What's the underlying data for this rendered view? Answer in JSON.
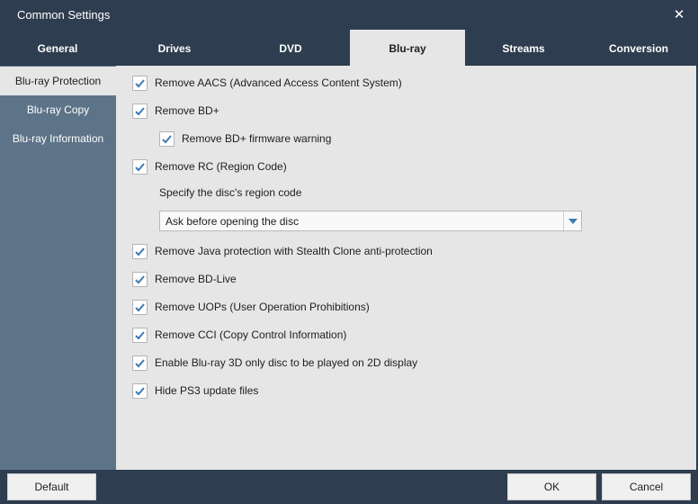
{
  "window": {
    "title": "Common Settings",
    "close_icon": "close-icon"
  },
  "tabs": [
    {
      "label": "General",
      "active": false
    },
    {
      "label": "Drives",
      "active": false
    },
    {
      "label": "DVD",
      "active": false
    },
    {
      "label": "Blu-ray",
      "active": true
    },
    {
      "label": "Streams",
      "active": false
    },
    {
      "label": "Conversion",
      "active": false
    }
  ],
  "sidebar": {
    "items": [
      {
        "label": "Blu-ray Protection",
        "active": true
      },
      {
        "label": "Blu-ray Copy",
        "active": false
      },
      {
        "label": "Blu-ray Information",
        "active": false
      }
    ]
  },
  "options": [
    {
      "label": "Remove AACS (Advanced Access Content System)",
      "checked": true
    },
    {
      "label": "Remove BD+",
      "checked": true
    },
    {
      "label": "Remove BD+ firmware warning",
      "checked": true
    },
    {
      "label": "Remove RC (Region Code)",
      "checked": true
    },
    {
      "label": "Remove Java protection with Stealth Clone anti-protection",
      "checked": true
    },
    {
      "label": "Remove BD-Live",
      "checked": true
    },
    {
      "label": "Remove UOPs (User Operation Prohibitions)",
      "checked": true
    },
    {
      "label": "Remove CCI (Copy Control Information)",
      "checked": true
    },
    {
      "label": "Enable Blu-ray 3D only disc to be played on 2D display",
      "checked": true
    },
    {
      "label": "Hide PS3 update files",
      "checked": true
    }
  ],
  "region": {
    "label": "Specify the disc's region code",
    "selected": "Ask before opening the disc"
  },
  "footer": {
    "default_label": "Default",
    "ok_label": "OK",
    "cancel_label": "Cancel"
  },
  "colors": {
    "header_bg": "#2e3d4f",
    "sidebar_bg": "#5d7388",
    "content_bg": "#e6e6e6",
    "check_color": "#3c7bb0"
  }
}
